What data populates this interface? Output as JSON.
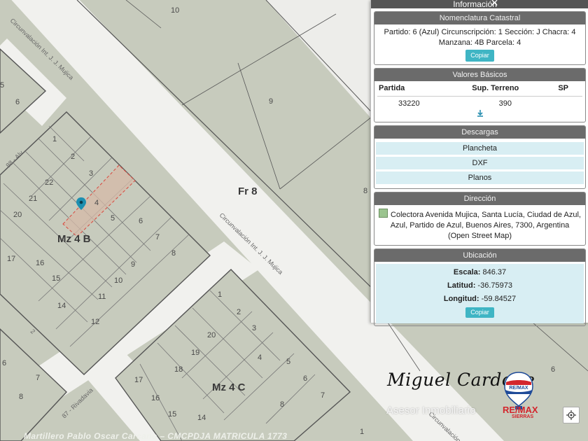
{
  "map": {
    "blocks": [
      {
        "key": "fr8",
        "label": "Fr 8"
      },
      {
        "key": "mz4b",
        "label": "Mz 4 B"
      },
      {
        "key": "mz4c",
        "label": "Mz 4 C"
      }
    ],
    "streets": {
      "main_top": "Circunvalación Int. J. J. Mujica",
      "main_mid": "Circunvalación Int. J. J. Mujica",
      "main_low": "Circunvalación",
      "rivadavia": "87 - Rivadavia",
      "alvear": "88 - Alv...",
      "two": "2"
    },
    "parcels": {
      "top_left_5": "5",
      "top_left_6": "6",
      "top_10": "10",
      "fr_9": "9",
      "right_8": "8",
      "b1": "1",
      "b2": "2",
      "b3": "3",
      "b4": "4",
      "b5": "5",
      "b6": "6",
      "b7": "7",
      "b8": "8",
      "b9": "9",
      "b10": "10",
      "b11": "11",
      "b12": "12",
      "b14": "14",
      "b15": "15",
      "b16": "16",
      "b17": "17",
      "b20": "20",
      "b21": "21",
      "b22": "22",
      "c1": "1",
      "c2": "2",
      "c3": "3",
      "c4": "4",
      "c5": "5",
      "c6": "6",
      "c7": "7",
      "c8": "8",
      "c14": "14",
      "c15": "15",
      "c16": "16",
      "c17": "17",
      "c18": "18",
      "c19": "19",
      "c20": "20",
      "l6": "6",
      "l7": "7",
      "l8": "8",
      "r6": "6",
      "r1": "1"
    },
    "selected_parcel_color": "#d9463c",
    "marker_color": "#1d8fb0",
    "locate_icon": "crosshair-icon"
  },
  "panel": {
    "title": "Información",
    "close": "×",
    "nomenclatura": {
      "header": "Nomenclatura Catastral",
      "text": "Partido: 6 (Azul) Circunscripción: 1 Sección: J Chacra: 4 Manzana: 4B Parcela: 4",
      "copy": "Copiar"
    },
    "valores": {
      "header": "Valores Básicos",
      "columns": [
        "Partida",
        "Sup. Terreno",
        "SP"
      ],
      "row": [
        "33220",
        "390",
        ""
      ],
      "download_icon": "download-icon"
    },
    "descargas": {
      "header": "Descargas",
      "items": [
        "Plancheta",
        "DXF",
        "Planos"
      ]
    },
    "direccion": {
      "header": "Dirección",
      "text": "Colectora Avenida Mujica, Santa Lucía, Ciudad de Azul, Azul, Partido de Azul, Buenos Aires, 7300, Argentina (Open Street Map)"
    },
    "ubicacion": {
      "header": "Ubicación",
      "escala_label": "Escala:",
      "escala_value": "846.37",
      "latitud_label": "Latitud:",
      "latitud_value": "-36.75973",
      "longitud_label": "Longitud:",
      "longitud_value": "-59.84527",
      "copy": "Copiar"
    }
  },
  "branding": {
    "signature": "Miguel Cardone",
    "role": "Asesor Inmobiliario",
    "remax": "RE/MAX",
    "remax_sub": "SIERRAS",
    "remax_badge": "RE/MAX",
    "watermark": "Martillero Pablo Oscar Carcano – CMCPDJA MATRICULA 1773"
  }
}
